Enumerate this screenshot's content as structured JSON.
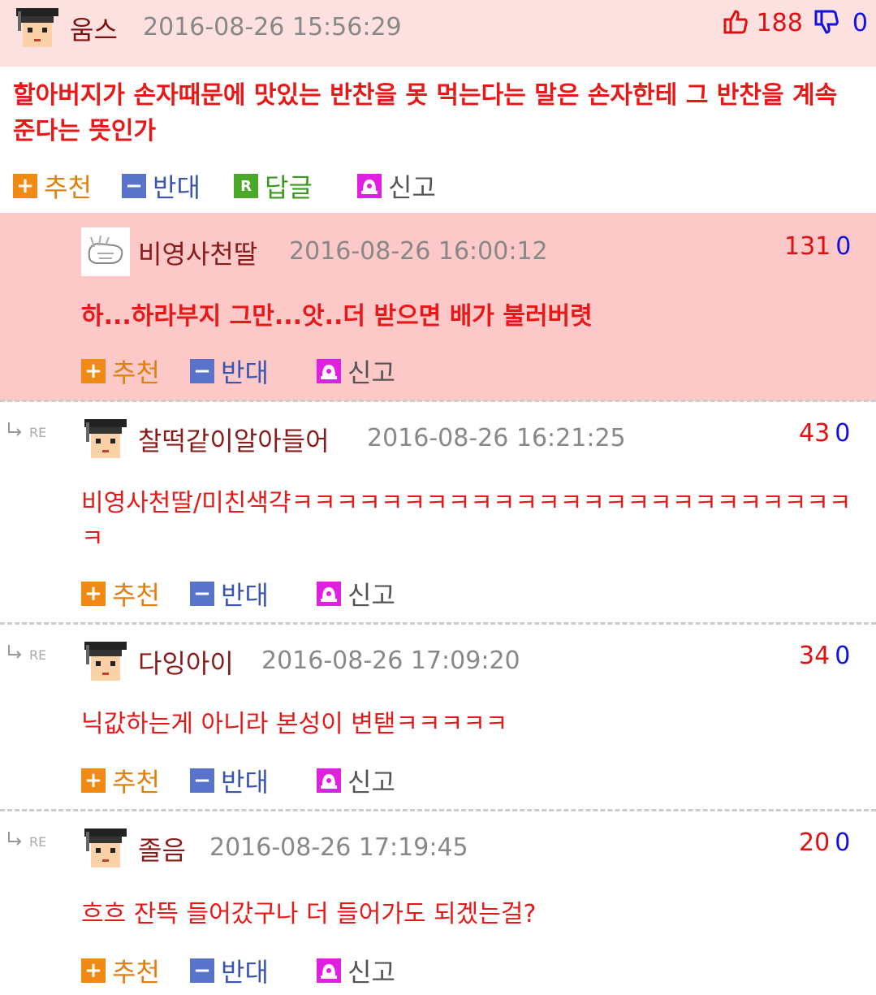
{
  "main": {
    "nick": "움스",
    "date": "2016-08-26 15:56:29",
    "up": "188",
    "down": "0",
    "text": "할아버지가 손자때문에 맛있는 반찬을 못 먹는다는 말은 손자한테 그 반찬을 계속 준다는 뜻인가",
    "actions": {
      "recommend": "추천",
      "oppose": "반대",
      "reply": "답글",
      "report": "신고",
      "reply_icon": "R"
    }
  },
  "comments": [
    {
      "nick": "비영사천딸",
      "date": "2016-08-26 16:00:12",
      "up": "131",
      "down": "0",
      "text": "하...하라부지 그만...앗..더 받으면 배가 불러버렷"
    },
    {
      "nick": "찰떡같이알아들어",
      "date": "2016-08-26 16:21:25",
      "up": "43",
      "down": "0",
      "text": "비영사천딸/미친색갹ㅋㅋㅋㅋㅋㅋㅋㅋㅋㅋㅋㅋㅋㅋㅋㅋㅋㅋㅋㅋㅋㅋㅋㅋㅋㅋ"
    },
    {
      "nick": "다잉아이",
      "date": "2016-08-26 17:09:20",
      "up": "34",
      "down": "0",
      "text": "닉값하는게 아니라 본성이 변탣ㅋㅋㅋㅋㅋ"
    },
    {
      "nick": "졸음",
      "date": "2016-08-26 17:19:45",
      "up": "20",
      "down": "0",
      "text": "흐흐 잔뜩 들어갔구나 더 들어가도 되겠는걸?"
    }
  ],
  "labels": {
    "recommend": "추천",
    "oppose": "반대",
    "report": "신고",
    "re": "RE"
  },
  "colors": {
    "up": "#e01010",
    "down": "#1010e0",
    "text": "#e81818",
    "best_bg": "#fcc8c8"
  }
}
